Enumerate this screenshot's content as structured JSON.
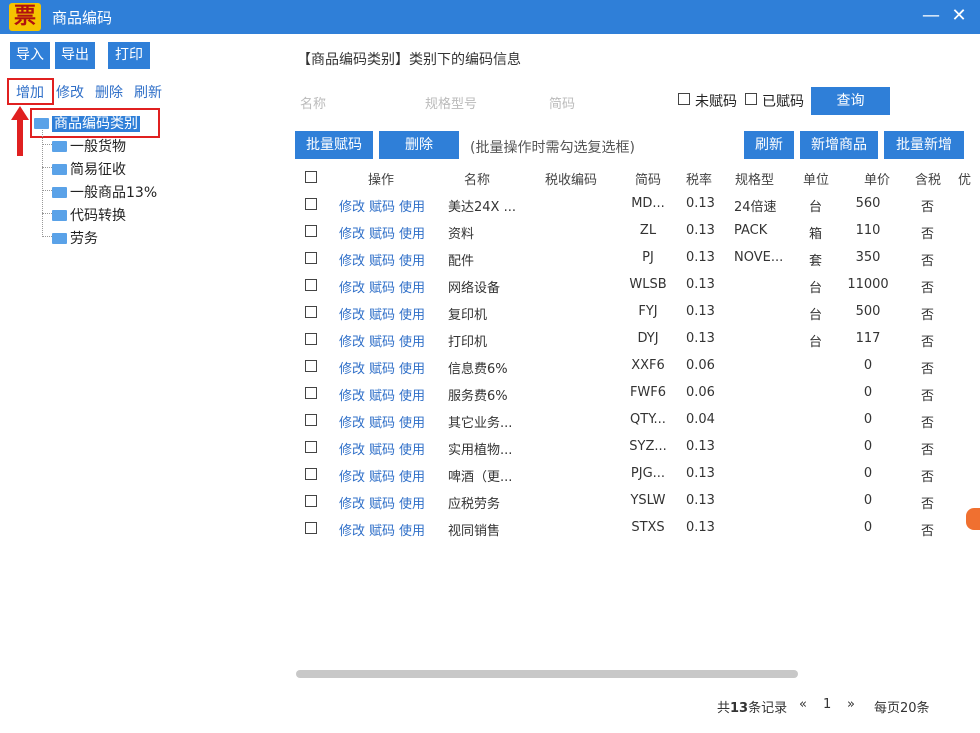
{
  "window": {
    "title": "商品编码",
    "logo": "票",
    "min": "—",
    "close": "✕"
  },
  "toolbar": {
    "import": "导入",
    "export": "导出",
    "print": "打印"
  },
  "tree_actions": {
    "add": "增加",
    "edit": "修改",
    "delete": "删除",
    "refresh": "刷新"
  },
  "tree": {
    "root": "商品编码类别",
    "children": [
      "一般货物",
      "简易征收",
      "一般商品13%",
      "代码转换",
      "劳务"
    ]
  },
  "heading": "【商品编码类别】类别下的编码信息",
  "search": {
    "name_ph": "名称",
    "spec_ph": "规格型号",
    "code_ph": "简码",
    "unassigned": "未赋码",
    "assigned": "已赋码",
    "query": "查询"
  },
  "actions": {
    "batch_assign": "批量赋码",
    "delete": "删除",
    "hint": "(批量操作时需勾选复选框)",
    "refresh": "刷新",
    "add_product": "新增商品",
    "batch_add": "批量新增"
  },
  "columns": [
    "操作",
    "名称",
    "税收编码",
    "简码",
    "税率",
    "规格型",
    "单位",
    "单价",
    "含税",
    "优"
  ],
  "op_labels": [
    "修改",
    "赋码",
    "使用"
  ],
  "rows": [
    {
      "name": "美达24X ...",
      "taxcode": "",
      "code": "MD...",
      "rate": "0.13",
      "spec": "24倍速",
      "unit": "台",
      "price": "560",
      "tax": "否"
    },
    {
      "name": "资料",
      "taxcode": "",
      "code": "ZL",
      "rate": "0.13",
      "spec": "PACK",
      "unit": "箱",
      "price": "110",
      "tax": "否"
    },
    {
      "name": "配件",
      "taxcode": "",
      "code": "PJ",
      "rate": "0.13",
      "spec": "NOVE...",
      "unit": "套",
      "price": "350",
      "tax": "否"
    },
    {
      "name": "网络设备",
      "taxcode": "",
      "code": "WLSB",
      "rate": "0.13",
      "spec": "",
      "unit": "台",
      "price": "11000",
      "tax": "否"
    },
    {
      "name": "复印机",
      "taxcode": "",
      "code": "FYJ",
      "rate": "0.13",
      "spec": "",
      "unit": "台",
      "price": "500",
      "tax": "否"
    },
    {
      "name": "打印机",
      "taxcode": "",
      "code": "DYJ",
      "rate": "0.13",
      "spec": "",
      "unit": "台",
      "price": "117",
      "tax": "否"
    },
    {
      "name": "信息费6%",
      "taxcode": "",
      "code": "XXF6",
      "rate": "0.06",
      "spec": "",
      "unit": "",
      "price": "0",
      "tax": "否"
    },
    {
      "name": "服务费6%",
      "taxcode": "",
      "code": "FWF6",
      "rate": "0.06",
      "spec": "",
      "unit": "",
      "price": "0",
      "tax": "否"
    },
    {
      "name": "其它业务...",
      "taxcode": "",
      "code": "QTY...",
      "rate": "0.04",
      "spec": "",
      "unit": "",
      "price": "0",
      "tax": "否"
    },
    {
      "name": "实用植物...",
      "taxcode": "",
      "code": "SYZ...",
      "rate": "0.13",
      "spec": "",
      "unit": "",
      "price": "0",
      "tax": "否"
    },
    {
      "name": "啤酒（更...",
      "taxcode": "",
      "code": "PJG...",
      "rate": "0.13",
      "spec": "",
      "unit": "",
      "price": "0",
      "tax": "否"
    },
    {
      "name": "应税劳务",
      "taxcode": "",
      "code": "YSLW",
      "rate": "0.13",
      "spec": "",
      "unit": "",
      "price": "0",
      "tax": "否"
    },
    {
      "name": "视同销售",
      "taxcode": "",
      "code": "STXS",
      "rate": "0.13",
      "spec": "",
      "unit": "",
      "price": "0",
      "tax": "否"
    }
  ],
  "pagination": {
    "total_prefix": "共",
    "total": "13",
    "total_suffix": "条记录",
    "prev": "«",
    "page": "1",
    "next": "»",
    "per_page": "每页20条"
  },
  "colors": {
    "accent": "#2f7fd8",
    "highlight": "#e02020"
  }
}
